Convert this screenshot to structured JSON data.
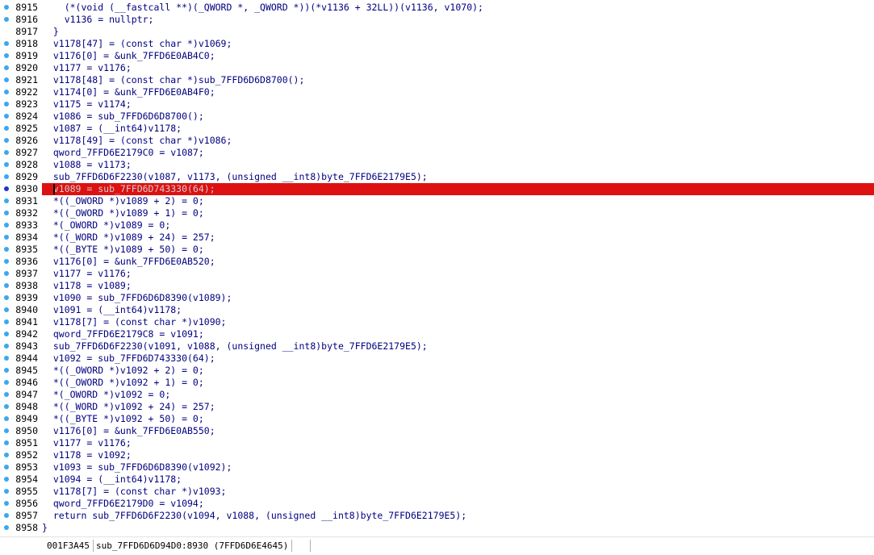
{
  "code_lines": [
    {
      "n": "8915",
      "text": "    (*(void (__fastcall **)(_QWORD *, _QWORD *))(*v1136 + 32LL))(v1136, v1070);",
      "dot": true
    },
    {
      "n": "8916",
      "text": "    v1136 = nullptr;",
      "dot": true
    },
    {
      "n": "8917",
      "text": "  }",
      "dot": false
    },
    {
      "n": "8918",
      "text": "  v1178[47] = (const char *)v1069;",
      "dot": true
    },
    {
      "n": "8919",
      "text": "  v1176[0] = &unk_7FFD6E0AB4C0;",
      "dot": true
    },
    {
      "n": "8920",
      "text": "  v1177 = v1176;",
      "dot": true
    },
    {
      "n": "8921",
      "text": "  v1178[48] = (const char *)sub_7FFD6D6D8700();",
      "dot": true
    },
    {
      "n": "8922",
      "text": "  v1174[0] = &unk_7FFD6E0AB4F0;",
      "dot": true
    },
    {
      "n": "8923",
      "text": "  v1175 = v1174;",
      "dot": true
    },
    {
      "n": "8924",
      "text": "  v1086 = sub_7FFD6D6D8700();",
      "dot": true
    },
    {
      "n": "8925",
      "text": "  v1087 = (__int64)v1178;",
      "dot": true
    },
    {
      "n": "8926",
      "text": "  v1178[49] = (const char *)v1086;",
      "dot": true
    },
    {
      "n": "8927",
      "text": "  qword_7FFD6E2179C0 = v1087;",
      "dot": true
    },
    {
      "n": "8928",
      "text": "  v1088 = v1173;",
      "dot": true
    },
    {
      "n": "8929",
      "text": "  sub_7FFD6D6F2230(v1087, v1173, (unsigned __int8)byte_7FFD6E2179E5);",
      "dot": true
    },
    {
      "n": "8930",
      "text": "  v1089 = sub_7FFD6D743330(64);",
      "dot": true,
      "highlight": true
    },
    {
      "n": "8931",
      "text": "  *((_OWORD *)v1089 + 2) = 0;",
      "dot": true
    },
    {
      "n": "8932",
      "text": "  *((_OWORD *)v1089 + 1) = 0;",
      "dot": true
    },
    {
      "n": "8933",
      "text": "  *(_OWORD *)v1089 = 0;",
      "dot": true
    },
    {
      "n": "8934",
      "text": "  *((_WORD *)v1089 + 24) = 257;",
      "dot": true
    },
    {
      "n": "8935",
      "text": "  *((_BYTE *)v1089 + 50) = 0;",
      "dot": true
    },
    {
      "n": "8936",
      "text": "  v1176[0] = &unk_7FFD6E0AB520;",
      "dot": true
    },
    {
      "n": "8937",
      "text": "  v1177 = v1176;",
      "dot": true
    },
    {
      "n": "8938",
      "text": "  v1178 = v1089;",
      "dot": true
    },
    {
      "n": "8939",
      "text": "  v1090 = sub_7FFD6D6D8390(v1089);",
      "dot": true
    },
    {
      "n": "8940",
      "text": "  v1091 = (__int64)v1178;",
      "dot": true
    },
    {
      "n": "8941",
      "text": "  v1178[7] = (const char *)v1090;",
      "dot": true
    },
    {
      "n": "8942",
      "text": "  qword_7FFD6E2179C8 = v1091;",
      "dot": true
    },
    {
      "n": "8943",
      "text": "  sub_7FFD6D6F2230(v1091, v1088, (unsigned __int8)byte_7FFD6E2179E5);",
      "dot": true
    },
    {
      "n": "8944",
      "text": "  v1092 = sub_7FFD6D743330(64);",
      "dot": true
    },
    {
      "n": "8945",
      "text": "  *((_OWORD *)v1092 + 2) = 0;",
      "dot": true
    },
    {
      "n": "8946",
      "text": "  *((_OWORD *)v1092 + 1) = 0;",
      "dot": true
    },
    {
      "n": "8947",
      "text": "  *(_OWORD *)v1092 = 0;",
      "dot": true
    },
    {
      "n": "8948",
      "text": "  *((_WORD *)v1092 + 24) = 257;",
      "dot": true
    },
    {
      "n": "8949",
      "text": "  *((_BYTE *)v1092 + 50) = 0;",
      "dot": true
    },
    {
      "n": "8950",
      "text": "  v1176[0] = &unk_7FFD6E0AB550;",
      "dot": true
    },
    {
      "n": "8951",
      "text": "  v1177 = v1176;",
      "dot": true
    },
    {
      "n": "8952",
      "text": "  v1178 = v1092;",
      "dot": true
    },
    {
      "n": "8953",
      "text": "  v1093 = sub_7FFD6D6D8390(v1092);",
      "dot": true
    },
    {
      "n": "8954",
      "text": "  v1094 = (__int64)v1178;",
      "dot": true
    },
    {
      "n": "8955",
      "text": "  v1178[7] = (const char *)v1093;",
      "dot": true
    },
    {
      "n": "8956",
      "text": "  qword_7FFD6E2179D0 = v1094;",
      "dot": true
    },
    {
      "n": "8957",
      "text": "  return sub_7FFD6D6F2230(v1094, v1088, (unsigned __int8)byte_7FFD6E2179E5);",
      "dot": true
    },
    {
      "n": "8958",
      "text": "}",
      "dot": true
    }
  ],
  "statusbar": {
    "address": "001F3A45",
    "location": "sub_7FFD6D6D94D0:8930 (7FFD6D6E4645)"
  },
  "colors": {
    "highlight": "#dd1111",
    "breakpoint_dot": "#3ba7f0",
    "code_text": "#000080"
  }
}
